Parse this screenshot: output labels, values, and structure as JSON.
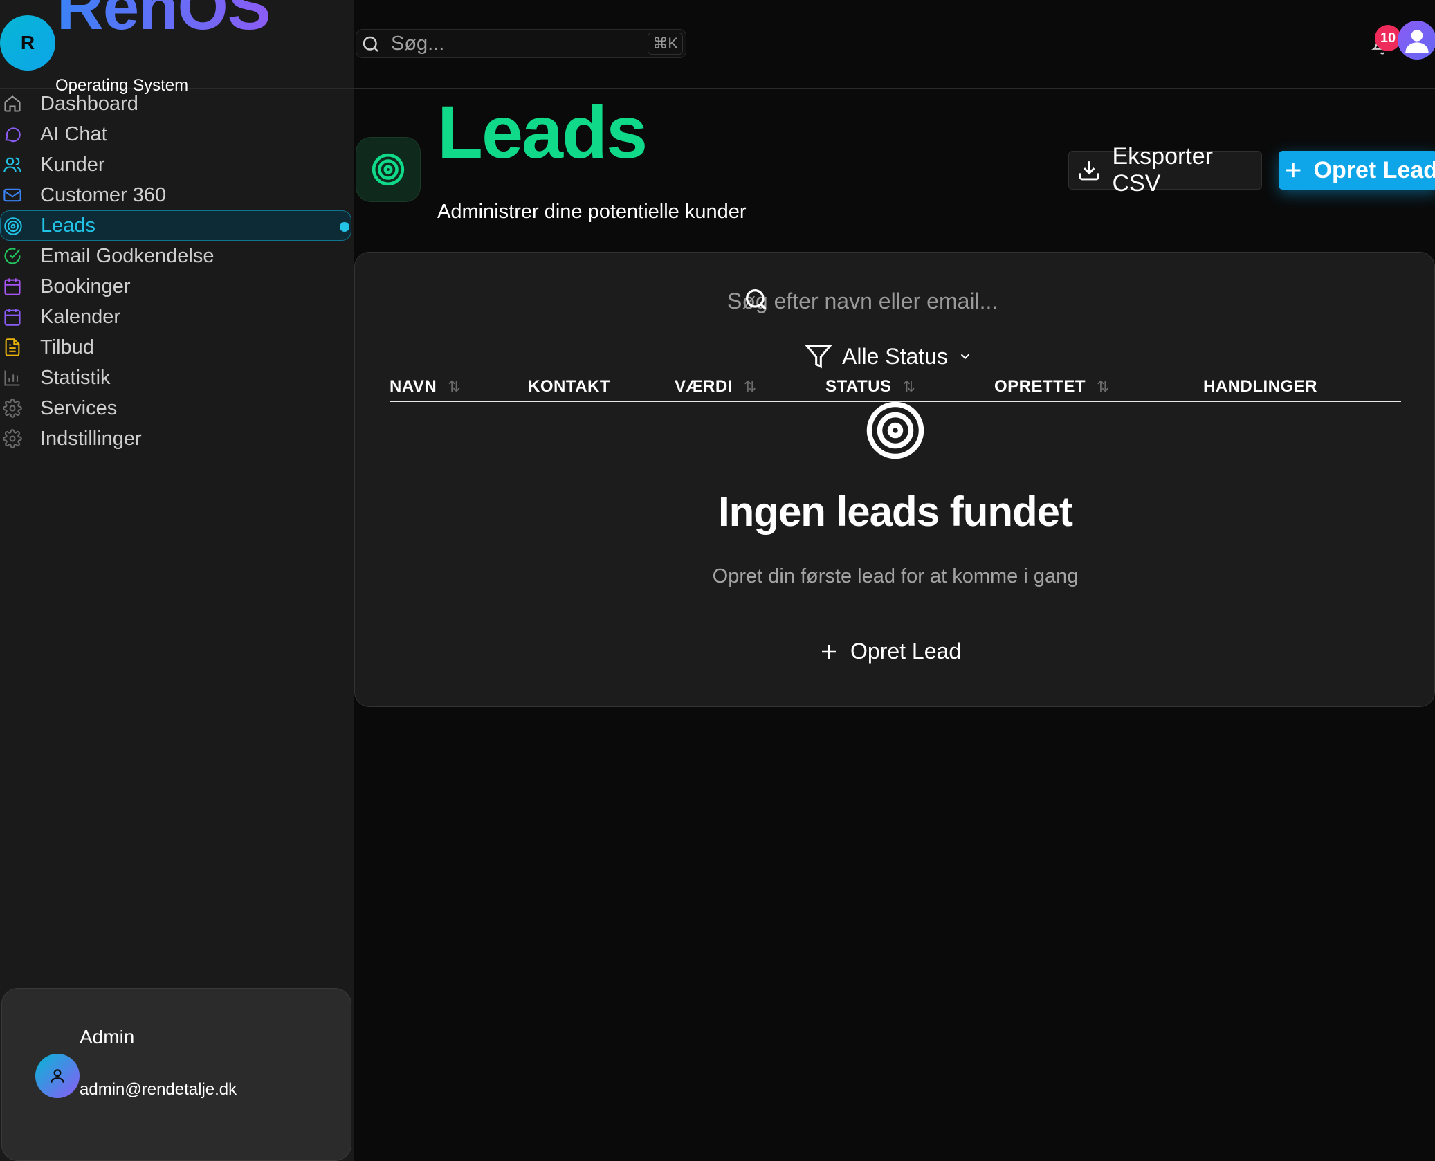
{
  "brand": {
    "avatar_letter": "R",
    "name": "RenOS",
    "subtitle": "Operating System"
  },
  "sidebar": {
    "items": [
      {
        "label": "Dashboard",
        "icon": "home-icon",
        "color": "#9a9a9a"
      },
      {
        "label": "AI Chat",
        "icon": "chat-icon",
        "color": "#8b5cf6"
      },
      {
        "label": "Kunder",
        "icon": "users-icon",
        "color": "#22c3e6"
      },
      {
        "label": "Customer 360",
        "icon": "mail-icon",
        "color": "#3b82f6"
      },
      {
        "label": "Leads",
        "icon": "target-icon",
        "color": "#22c3e6",
        "active": true
      },
      {
        "label": "Email Godkendelse",
        "icon": "check-circle-icon",
        "color": "#22c55e"
      },
      {
        "label": "Bookinger",
        "icon": "calendar-icon",
        "color": "#a855f7"
      },
      {
        "label": "Kalender",
        "icon": "calendar-grid-icon",
        "color": "#8b5cf6"
      },
      {
        "label": "Tilbud",
        "icon": "file-icon",
        "color": "#eab308"
      },
      {
        "label": "Statistik",
        "icon": "bar-chart-icon",
        "color": "#6b6b6b"
      },
      {
        "label": "Services",
        "icon": "gear-icon",
        "color": "#6b6b6b"
      },
      {
        "label": "Indstillinger",
        "icon": "gear-icon",
        "color": "#6b6b6b"
      }
    ]
  },
  "user": {
    "name": "Admin",
    "email": "admin@rendetalje.dk"
  },
  "topbar": {
    "search_placeholder": "Søg...",
    "shortcut": "⌘K",
    "notification_count": "10"
  },
  "header": {
    "title": "Leads",
    "subtitle": "Administrer dine potentielle kunder",
    "export_label": "Eksporter CSV",
    "create_label": "Opret Lead"
  },
  "filters": {
    "search_placeholder": "Søg efter navn eller email...",
    "status_label": "Alle Status"
  },
  "table": {
    "columns": [
      {
        "label": "NAVN",
        "sortable": true
      },
      {
        "label": "KONTAKT",
        "sortable": false
      },
      {
        "label": "VÆRDI",
        "sortable": true
      },
      {
        "label": "STATUS",
        "sortable": true
      },
      {
        "label": "OPRETTET",
        "sortable": true
      },
      {
        "label": "HANDLINGER",
        "sortable": false
      }
    ]
  },
  "empty": {
    "title": "Ingen leads fundet",
    "subtitle": "Opret din første lead for at komme i gang",
    "button_label": "Opret Lead"
  },
  "colors": {
    "accent": "#22c3e6",
    "title_green": "#10d98a",
    "primary_button": "#0ea5e9",
    "badge": "#ef2b5b"
  }
}
